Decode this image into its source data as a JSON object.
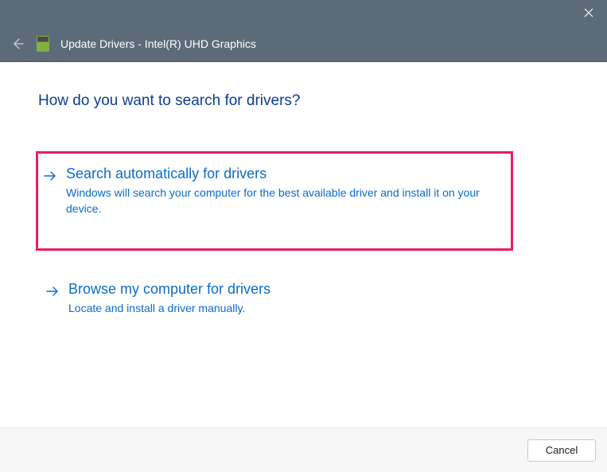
{
  "window": {
    "title": "Update Drivers - Intel(R) UHD Graphics"
  },
  "heading": "How do you want to search for drivers?",
  "options": {
    "auto": {
      "title": "Search automatically for drivers",
      "desc": "Windows will search your computer for the best available driver and install it on your device."
    },
    "browse": {
      "title": "Browse my computer for drivers",
      "desc": "Locate and install a driver manually."
    }
  },
  "footer": {
    "cancel_label": "Cancel"
  }
}
